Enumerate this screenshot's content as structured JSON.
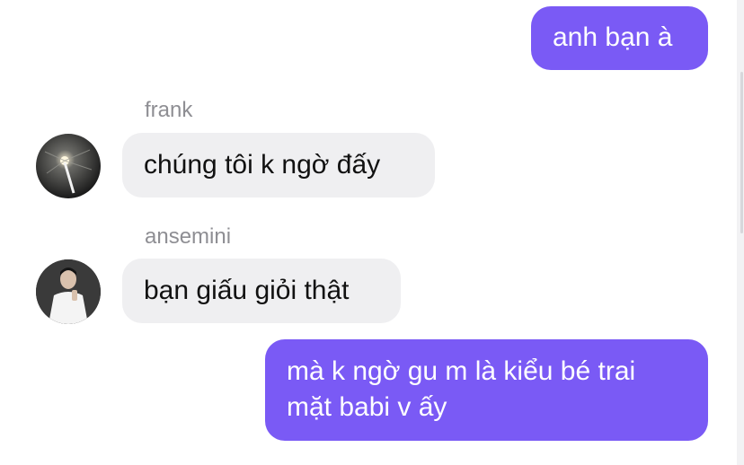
{
  "messages": [
    {
      "direction": "outgoing",
      "text": "anh bạn à"
    },
    {
      "direction": "incoming",
      "sender": "frank",
      "avatar_icon": "dark-photo-avatar",
      "text": "chúng tôi k ngờ đấy"
    },
    {
      "direction": "incoming",
      "sender": "ansemini",
      "avatar_icon": "person-photo-avatar",
      "text": "bạn giấu giỏi thật"
    },
    {
      "direction": "outgoing",
      "lines": [
        "mà k ngờ gu m là kiểu bé trai",
        "mặt babi v ấy"
      ]
    }
  ],
  "colors": {
    "outgoing_bubble": "#7a5af5",
    "incoming_bubble": "#efeff1",
    "sender_name": "#8e8e93"
  }
}
